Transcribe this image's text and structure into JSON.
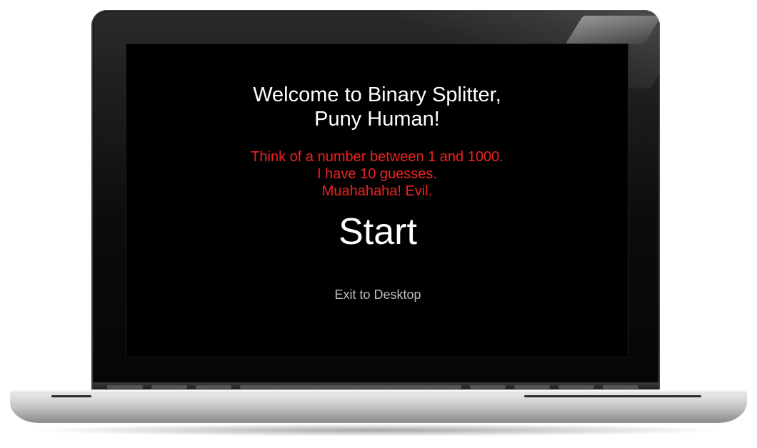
{
  "game": {
    "title_line1": "Welcome to Binary Splitter,",
    "title_line2": "Puny Human!",
    "instructions_line1": "Think of a number between 1 and 1000.",
    "instructions_line2": "I have 10 guesses.",
    "instructions_line3": "Muahahaha! Evil.",
    "start_label": "Start",
    "exit_label": "Exit to Desktop"
  },
  "colors": {
    "screen_background": "#000000",
    "title_text": "#ffffff",
    "instructions_text": "#ee2222",
    "exit_text": "#bdbdbd"
  }
}
